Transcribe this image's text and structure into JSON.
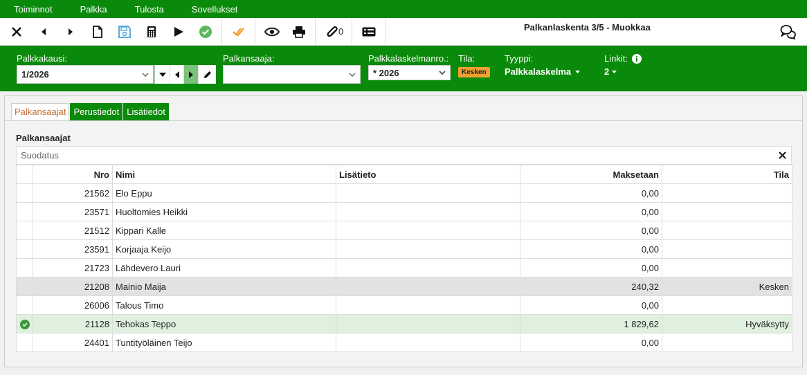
{
  "menu": [
    "Toiminnot",
    "Palkka",
    "Tulosta",
    "Sovellukset"
  ],
  "toolbar": {
    "title": "Palkanlaskenta 3/5 - Muokkaa",
    "attachment_count": "0",
    "icons": [
      "close-icon",
      "prev-icon",
      "next-icon",
      "new-document-icon",
      "save-icon",
      "calculator-icon",
      "play-icon",
      "approve-icon",
      "double-check-icon",
      "eye-icon",
      "print-icon",
      "paperclip-icon",
      "id-card-icon",
      "chat-icon"
    ]
  },
  "header": {
    "period_label": "Palkkakausi:",
    "period_value": "1/2026",
    "employee_label": "Palkansaaja:",
    "employee_value": "",
    "calcno_label": "Palkkalaskelmanro.:",
    "calcno_value": "* 2026",
    "status_label": "Tila:",
    "status_value": "Kesken",
    "type_label": "Tyyppi:",
    "type_value": "Palkkalaskelma",
    "links_label": "Linkit:",
    "links_value": "2"
  },
  "tabs": [
    "Palkansaajat",
    "Perustiedot",
    "Lisätiedot"
  ],
  "section": {
    "title": "Palkansaajat",
    "filter_placeholder": "Suodatus"
  },
  "table": {
    "columns": [
      "",
      "Nro",
      "Nimi",
      "Lisätieto",
      "Maksetaan",
      "Tila"
    ],
    "rows": [
      {
        "nro": "21562",
        "nimi": "Elo Eppu",
        "lisatieto": "",
        "maksetaan": "0,00",
        "tila": "",
        "state": ""
      },
      {
        "nro": "23571",
        "nimi": "Huoltomies Heikki",
        "lisatieto": "",
        "maksetaan": "0,00",
        "tila": "",
        "state": ""
      },
      {
        "nro": "21512",
        "nimi": "Kippari Kalle",
        "lisatieto": "",
        "maksetaan": "0,00",
        "tila": "",
        "state": ""
      },
      {
        "nro": "23591",
        "nimi": "Korjaaja Keijo",
        "lisatieto": "",
        "maksetaan": "0,00",
        "tila": "",
        "state": ""
      },
      {
        "nro": "21723",
        "nimi": "Lähdevero Lauri",
        "lisatieto": "",
        "maksetaan": "0,00",
        "tila": "",
        "state": ""
      },
      {
        "nro": "21208",
        "nimi": "Mainio Maija",
        "lisatieto": "",
        "maksetaan": "240,32",
        "tila": "Kesken",
        "state": "sel"
      },
      {
        "nro": "26006",
        "nimi": "Talous Timo",
        "lisatieto": "",
        "maksetaan": "0,00",
        "tila": "",
        "state": ""
      },
      {
        "nro": "21128",
        "nimi": "Tehokas Teppo",
        "lisatieto": "",
        "maksetaan": "1 829,62",
        "tila": "Hyväksytty",
        "state": "ok"
      },
      {
        "nro": "24401",
        "nimi": "Tuntityöläinen Teijo",
        "lisatieto": "",
        "maksetaan": "0,00",
        "tila": "",
        "state": ""
      }
    ]
  },
  "colors": {
    "brand_green": "#0a8a0a",
    "badge_orange": "#f0a030",
    "approved_row": "#dff0df",
    "selected_row": "#e2e2e2"
  }
}
